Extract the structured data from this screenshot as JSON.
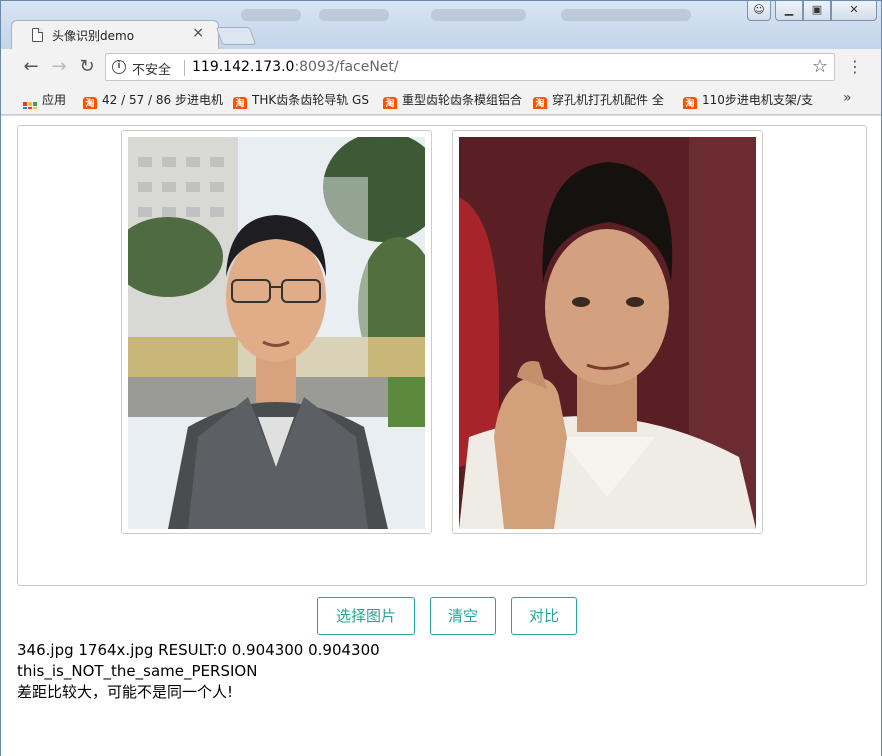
{
  "browser": {
    "tab_title": "头像识别demo",
    "tab_close": "×",
    "security_label": "不安全",
    "url_host": "119.142.173.0",
    "url_port": ":8093",
    "url_path": "/faceNet/",
    "controls": {
      "minimize": "▭",
      "maximize": "⧉",
      "close": "✕",
      "user": "☺"
    }
  },
  "bookmarks": {
    "apps_label": "应用",
    "items": [
      {
        "label": "42 / 57 / 86 步进电机",
        "icon": "taobao-icon"
      },
      {
        "label": "THK齿条齿轮导轨 GS",
        "icon": "taobao-icon"
      },
      {
        "label": "重型齿轮齿条模组铝合",
        "icon": "taobao-icon"
      },
      {
        "label": "穿孔机打孔机配件 全",
        "icon": "taobao-icon"
      },
      {
        "label": "110步进电机支架/支",
        "icon": "taobao-icon"
      }
    ],
    "overflow": "»"
  },
  "page": {
    "buttons": {
      "choose": "选择图片",
      "clear": "清空",
      "compare": "对比"
    },
    "result_lines": [
      "346.jpg 1764x.jpg RESULT:0 0.904300 0.904300",
      "this_is_NOT_the_same_PERSION",
      "差距比较大，可能不是同一个人!"
    ]
  },
  "colors": {
    "accent": "#26a69a",
    "taobao": "#ff5000"
  }
}
